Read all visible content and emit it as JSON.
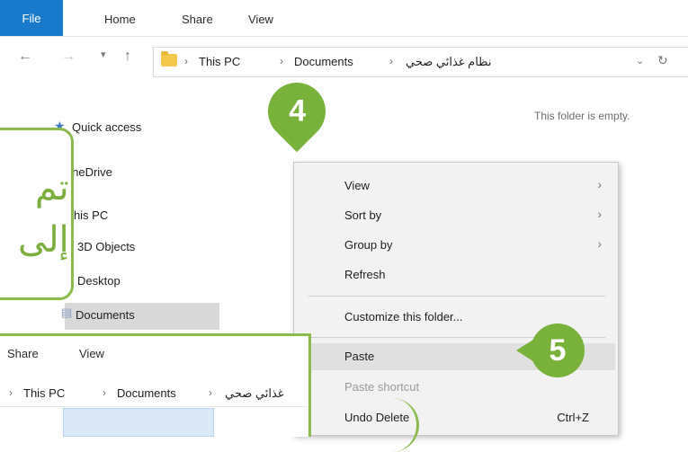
{
  "ribbon": {
    "tabs": [
      "File",
      "Home",
      "Share",
      "View"
    ]
  },
  "address": {
    "crumbs": [
      "This PC",
      "Documents",
      "نظام غذائي صحي"
    ]
  },
  "sidebar": {
    "items": [
      "Quick access",
      "OneDrive",
      "This PC",
      "3D Objects",
      "Desktop",
      "Documents"
    ]
  },
  "main": {
    "empty_message": "This folder is empty."
  },
  "callout_left": {
    "line1": "تم",
    "line2": "إلى"
  },
  "context_menu": {
    "items": [
      {
        "label": "View"
      },
      {
        "label": "Sort by"
      },
      {
        "label": "Group by"
      },
      {
        "label": "Refresh"
      },
      {
        "label": "Customize this folder..."
      },
      {
        "label": "Paste"
      },
      {
        "label": "Paste shortcut"
      },
      {
        "label": "Undo Delete",
        "shortcut": "Ctrl+Z"
      }
    ]
  },
  "badges": {
    "step4": "4",
    "step5": "5"
  },
  "inset": {
    "tabs": [
      "Share",
      "View"
    ],
    "crumbs": [
      "This PC",
      "Documents",
      "غذائي صحي"
    ]
  },
  "colors": {
    "accent_green": "#79b23a",
    "file_tab_blue": "#1979ca"
  },
  "icons": [
    "back-arrow-icon",
    "forward-arrow-icon",
    "up-arrow-icon",
    "folder-icon",
    "refresh-icon",
    "chevron-right-icon"
  ]
}
